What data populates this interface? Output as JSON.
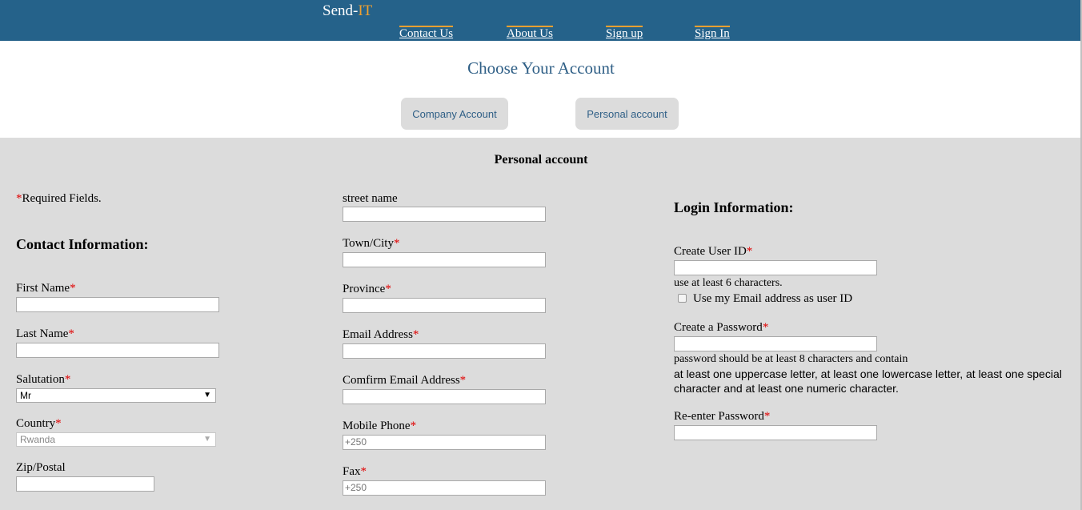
{
  "brand": {
    "name_part1": "Send-",
    "name_part2": "IT"
  },
  "nav": {
    "contact": "Contact Us",
    "about": "About Us",
    "signup": "Sign up",
    "signin": "Sign In"
  },
  "chooser": {
    "title": "Choose Your Account",
    "company": "Company Account",
    "personal": "Personal account"
  },
  "form": {
    "title": "Personal account",
    "required_note": "Required Fields.",
    "required_mark": "*",
    "contact_heading": "Contact Information:",
    "first_name": "First Name",
    "last_name": "Last Name",
    "salutation": "Salutation",
    "salutation_value": "Mr",
    "country": "Country",
    "country_value": "Rwanda",
    "zip": "Zip/Postal",
    "street": "street name",
    "town": "Town/City",
    "province": "Province",
    "email": "Email Address",
    "confirm_email": "Comfirm Email Address",
    "mobile": "Mobile Phone",
    "mobile_placeholder": "+250",
    "fax": "Fax",
    "fax_placeholder": "+250",
    "login_heading": "Login Information:",
    "user_id": "Create User ID",
    "user_id_hint": "use at least 6 characters.",
    "use_email": "Use my Email address as user ID",
    "password": "Create a Password",
    "password_hint_1": "password should be at least 8 characters and contain",
    "password_hint_2": "at least one uppercase letter, at least one lowercase letter, at least one special character and at least one numeric character.",
    "reenter": "Re-enter Password"
  },
  "colors": {
    "header": "#25628a",
    "accent": "#f0a030",
    "required": "#e00000",
    "background": "#dcdcdc"
  }
}
